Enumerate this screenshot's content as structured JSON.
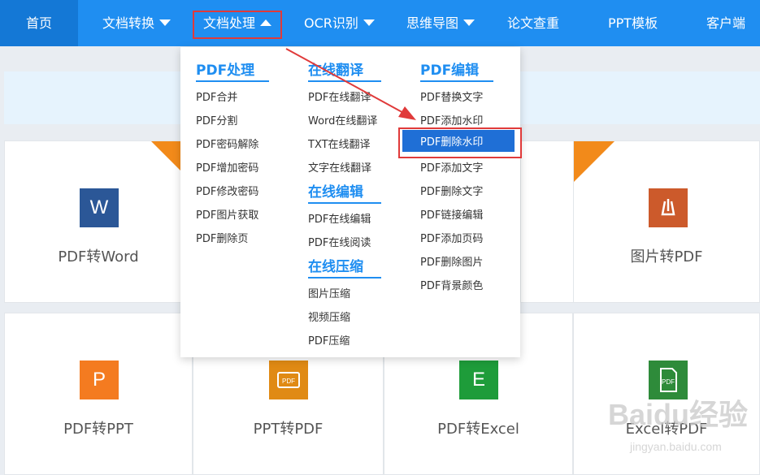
{
  "nav": {
    "home": "首页",
    "convert": "文档转换",
    "process": "文档处理",
    "ocr": "OCR识别",
    "mindmap": "思维导图",
    "thesis": "论文查重",
    "ppt": "PPT模板",
    "client": "客户端"
  },
  "dropdown": {
    "col1": {
      "title": "PDF处理",
      "items": [
        "PDF合并",
        "PDF分割",
        "PDF密码解除",
        "PDF增加密码",
        "PDF修改密码",
        "PDF图片获取",
        "PDF删除页"
      ]
    },
    "col2": {
      "title": "在线翻译",
      "items": [
        "PDF在线翻译",
        "Word在线翻译",
        "TXT在线翻译",
        "文字在线翻译"
      ],
      "title2": "在线编辑",
      "items2": [
        "PDF在线编辑",
        "PDF在线阅读"
      ],
      "title3": "在线压缩",
      "items3": [
        "图片压缩",
        "视频压缩",
        "PDF压缩"
      ]
    },
    "col3": {
      "title": "PDF编辑",
      "items": [
        "PDF替换文字",
        "PDF添加水印",
        "PDF删除水印",
        "PDF添加文字",
        "PDF删除文字",
        "PDF链接编辑",
        "PDF添加页码",
        "PDF删除图片",
        "PDF背景颜色"
      ]
    }
  },
  "cards": {
    "c1": {
      "label": "PDF转Word",
      "icon_letter": "W",
      "color": "#2b5797"
    },
    "c2": {
      "label": "图片转PDF",
      "icon": "pdf-icon",
      "color": "#cc5a2b"
    },
    "c3": {
      "label": "PDF转PPT",
      "icon_letter": "P",
      "color": "#f47b20"
    },
    "c4": {
      "label": "PPT转PDF",
      "icon": "pdf-icon",
      "color": "#e08a14"
    },
    "c5": {
      "label": "PDF转Excel",
      "icon_letter": "E",
      "color": "#1e9c3a"
    },
    "c6": {
      "label": "Excel转PDF",
      "icon": "pdf-icon",
      "color": "#2e8b3a"
    }
  },
  "colors": {
    "primary": "#1f8ef1",
    "highlight": "#1f6fd6",
    "annotation": "#e03a3a",
    "hot": "#f28a1a"
  },
  "watermark": {
    "brand": "Baidu经验",
    "url": "jingyan.baidu.com"
  }
}
